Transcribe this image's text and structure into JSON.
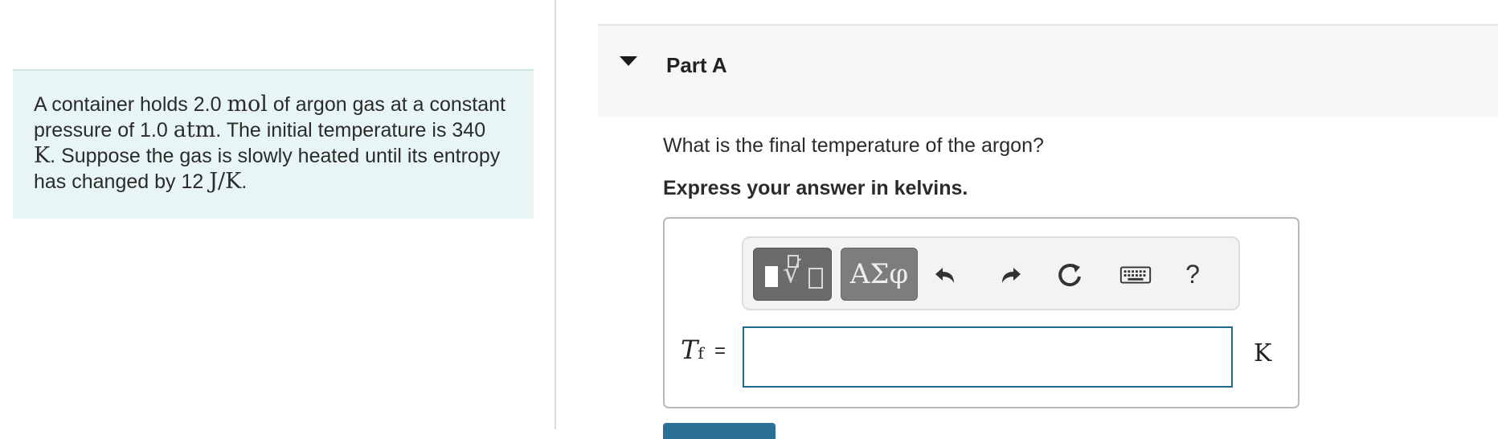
{
  "problem": {
    "segments": [
      {
        "t": "A container holds 2.0 ",
        "math": false
      },
      {
        "t": "mol",
        "math": true
      },
      {
        "t": " of argon gas at a constant pressure of 1.0 ",
        "math": false
      },
      {
        "t": "atm",
        "math": true
      },
      {
        "t": ". The initial temperature is 340 ",
        "math": false
      },
      {
        "t": "K",
        "math": true
      },
      {
        "t": ". Suppose the gas is slowly heated until its entropy has changed by 12 ",
        "math": false
      },
      {
        "t": "J/K",
        "math": true
      },
      {
        "t": ".",
        "math": false
      }
    ]
  },
  "part": {
    "title": "Part A"
  },
  "question": "What is the final temperature of the argon?",
  "instruction": "Express your answer in kelvins.",
  "toolbar": {
    "greek_label": "ΑΣφ",
    "help_label": "?",
    "icons": [
      "templates-icon",
      "greek-letters-icon",
      "undo-icon",
      "redo-icon",
      "reset-icon",
      "keyboard-icon",
      "help-icon"
    ]
  },
  "answer": {
    "variable": "T",
    "subscript": "f",
    "equals": "=",
    "value": "",
    "unit": "K"
  },
  "colors": {
    "problem_bg": "#e8f5f5",
    "input_border": "#1e6a8a",
    "submit": "#2b6e96"
  }
}
